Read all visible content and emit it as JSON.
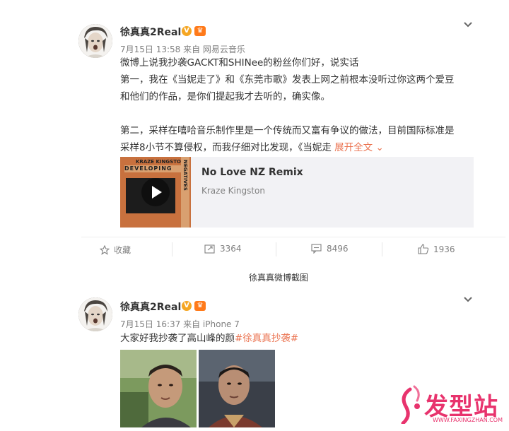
{
  "post1": {
    "username": "徐真真2Real",
    "verified_badge": "V",
    "member_badge": "crown-icon",
    "meta": "7月15日 13:58 来自 网易云音乐",
    "text_lines": [
      "微博上说我抄袭GACKT和SHINee的粉丝你们好，说实话",
      "第一，我在《当妮走了》和《东莞市歌》发表上网之前根本没听过你这两个爱豆",
      "和他们的作品，是你们提起我才去听的，确实像。",
      "",
      "第二，采样在嘻哈音乐制作里是一个传统而又富有争议的做法，目前国际标准是",
      "采样8小节不算侵权，而我仔细对比发现，《当妮走"
    ],
    "expand_label": "展开全文",
    "music_card": {
      "cover_text_top": "KRAZE KINGSTON",
      "cover_text_mid": "DEVELOPING",
      "cover_text_side": "NEGATIVES",
      "title": "No Love NZ Remix",
      "artist": "Kraze Kingston"
    },
    "actions": {
      "favorite": "收藏",
      "repost": "3364",
      "comment": "8496",
      "like": "1936"
    }
  },
  "caption": "徐真真微博截图",
  "post2": {
    "username": "徐真真2Real",
    "verified_badge": "V",
    "member_badge": "crown-icon",
    "meta": "7月15日 16:37 来自 iPhone 7",
    "text_plain": "大家好我抄袭了高山峰的颜",
    "text_tag": "#徐真真抄袭#"
  },
  "watermark": {
    "text": "发型站",
    "url": "WWW.FAXINGZHAN.COM"
  },
  "colors": {
    "accent_link": "#eb7350",
    "badge_gold": "#f5a623",
    "watermark_pink": "#e8336d"
  }
}
